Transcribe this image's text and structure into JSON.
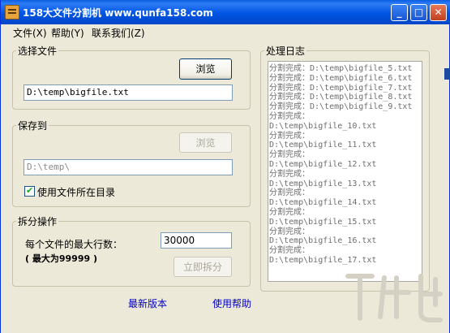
{
  "window": {
    "title": "158大文件分割机 www.qunfa158.com",
    "controls": {
      "minimize": "_",
      "maximize": "□",
      "close": "✕"
    }
  },
  "menu": [
    "文件(X)",
    "帮助(Y)",
    "联系我们(Z)"
  ],
  "select_file": {
    "group_label": "选择文件",
    "browse_label": "浏览",
    "path_value": "D:\\temp\\bigfile.txt"
  },
  "save_to": {
    "group_label": "保存到",
    "browse_label": "浏览",
    "path_value": "D:\\temp\\",
    "use_file_dir_label": "使用文件所在目录",
    "use_file_dir_checked": true
  },
  "split": {
    "group_label": "拆分操作",
    "max_lines_label": "每个文件的最大行数：",
    "max_lines_value": "30000",
    "max_hint": "( 最大为99999 )",
    "split_now_label": "立即拆分"
  },
  "log": {
    "group_label": "处理日志",
    "lines": [
      "分割完成：D:\\temp\\bigfile_5.txt",
      "分割完成：D:\\temp\\bigfile_6.txt",
      "分割完成：D:\\temp\\bigfile_7.txt",
      "分割完成：D:\\temp\\bigfile_8.txt",
      "分割完成：D:\\temp\\bigfile_9.txt",
      "分割完成：",
      "D:\\temp\\bigfile_10.txt",
      "分割完成：",
      "D:\\temp\\bigfile_11.txt",
      "分割完成：",
      "D:\\temp\\bigfile_12.txt",
      "分割完成：",
      "D:\\temp\\bigfile_13.txt",
      "分割完成：",
      "D:\\temp\\bigfile_14.txt",
      "分割完成：",
      "D:\\temp\\bigfile_15.txt",
      "分割完成：",
      "D:\\temp\\bigfile_16.txt",
      "分割完成：",
      "D:\\temp\\bigfile_17.txt"
    ]
  },
  "footer": {
    "latest_version": "最新版本",
    "help": "使用帮助"
  },
  "colors": {
    "titlebar": "#0054e3",
    "window_bg": "#ece9d8",
    "link": "#0000c8",
    "check": "#21a121"
  }
}
